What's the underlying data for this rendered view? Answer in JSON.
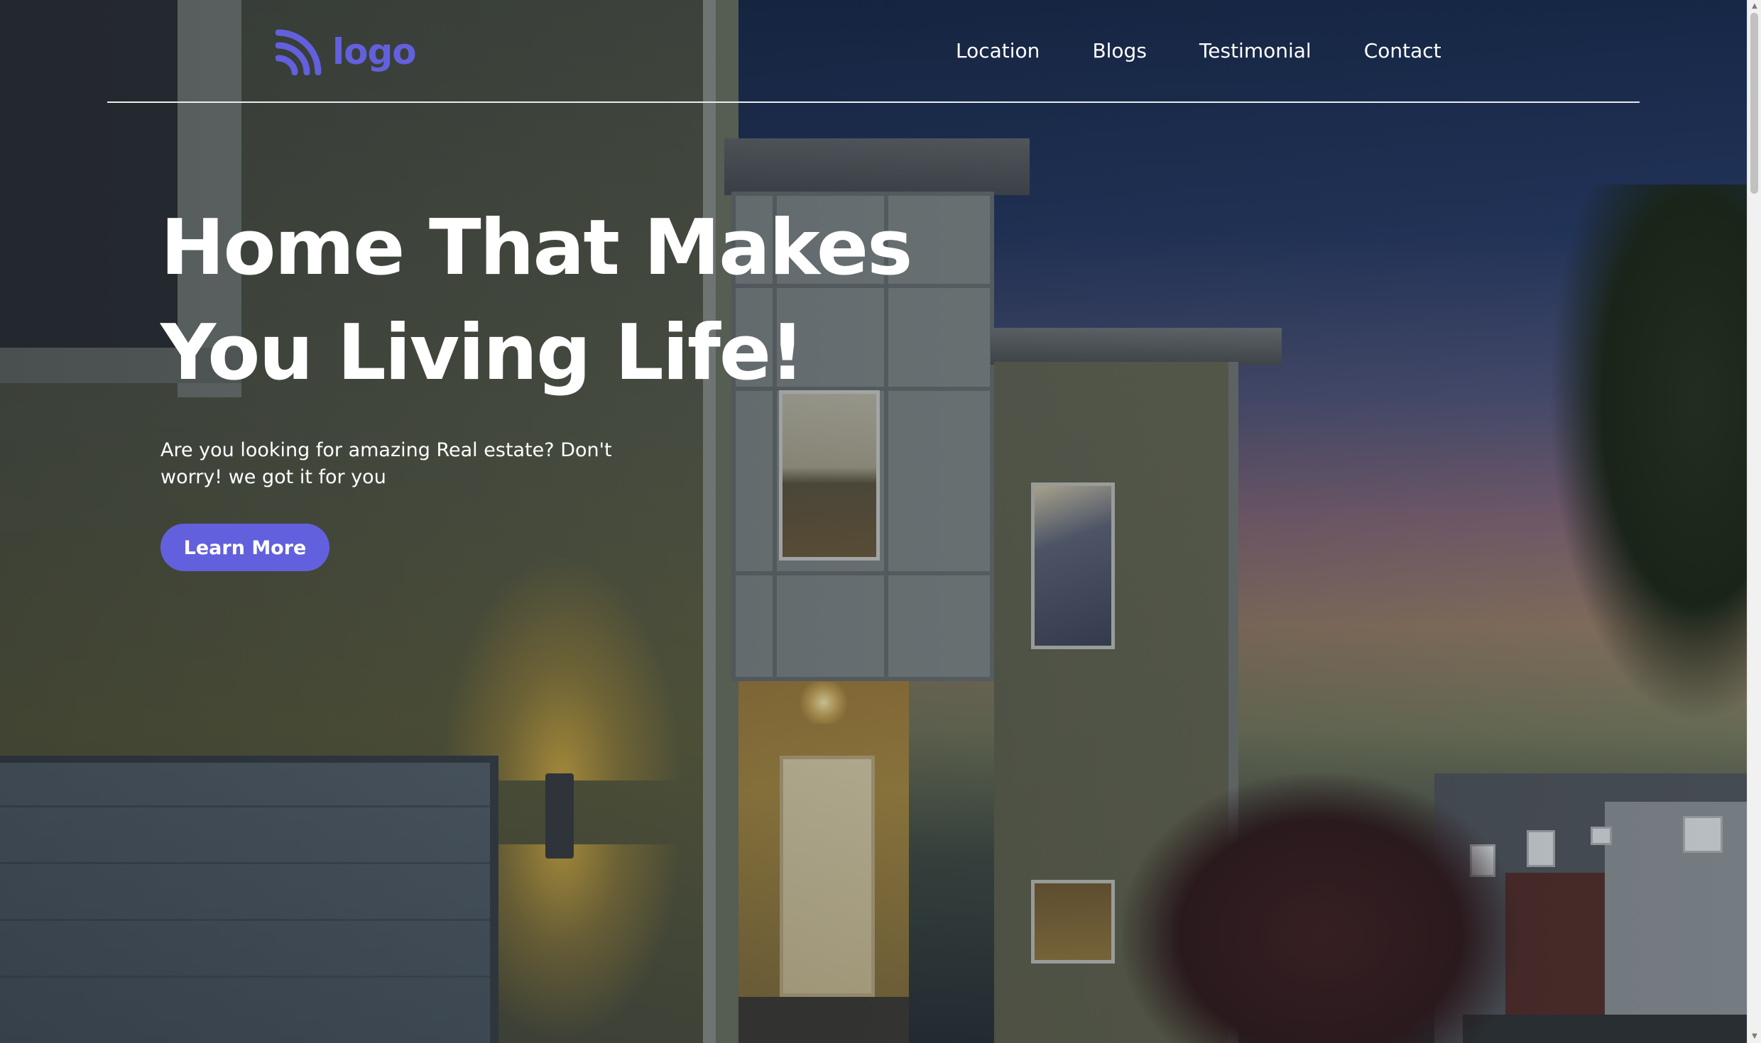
{
  "brand": {
    "logo_text": "logo",
    "logo_icon": "signal-waves-icon",
    "accent_color": "#6360dd"
  },
  "nav": {
    "items": [
      {
        "label": "Location"
      },
      {
        "label": "Blogs"
      },
      {
        "label": "Testimonial"
      },
      {
        "label": "Contact"
      }
    ]
  },
  "hero": {
    "title_line1": "Home That Makes",
    "title_line2": "You Living Life!",
    "subtitle": "Are you looking for amazing Real estate? Don't worry! we got it for you",
    "cta_label": "Learn More"
  },
  "background": {
    "image_subject": "house-at-dusk-photo"
  },
  "scrollbar": {
    "up_icon": "scroll-up-arrow-icon",
    "down_icon": "scroll-down-arrow-icon"
  }
}
